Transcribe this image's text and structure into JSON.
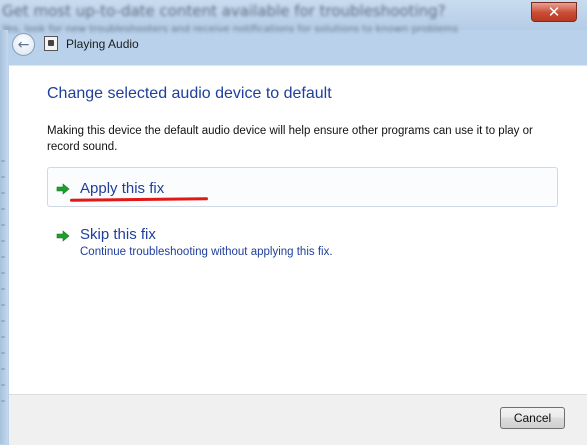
{
  "background": {
    "window_title_text": "Get most up-to-date content available for troubleshooting?",
    "window_subtitle_text": "Yes, look for new troubleshooters and receive notifications for solutions to known problems"
  },
  "window": {
    "close_label": "✕",
    "title": "Playing Audio"
  },
  "main": {
    "heading": "Change selected audio device to default",
    "description": "Making this device the default audio device will help ensure other programs can use it to play or record sound.",
    "options": [
      {
        "label": "Apply this fix",
        "description": ""
      },
      {
        "label": "Skip this fix",
        "description": "Continue troubleshooting without applying this fix."
      }
    ]
  },
  "footer": {
    "cancel_label": "Cancel"
  },
  "colors": {
    "link_blue": "#1f3f9b",
    "arrow_green": "#1e9e2c",
    "annotation_red": "#e01818"
  }
}
